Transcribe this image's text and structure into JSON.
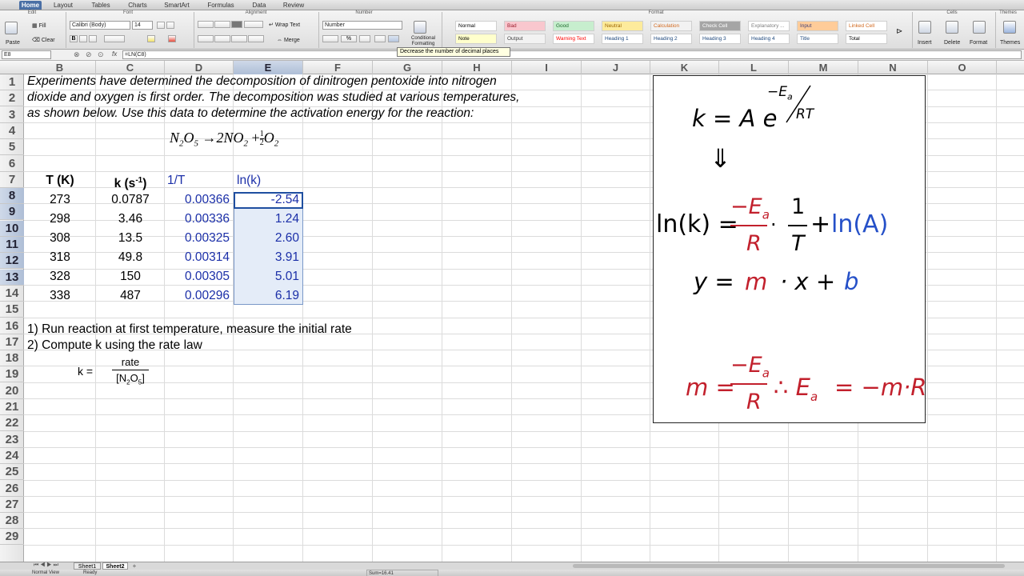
{
  "ribbon": {
    "tabs": [
      "Home",
      "Layout",
      "Tables",
      "Charts",
      "SmartArt",
      "Formulas",
      "Data",
      "Review"
    ],
    "groups": {
      "edit": "Edit",
      "font": "Font",
      "alignment": "Alignment",
      "number": "Number",
      "format": "Format",
      "cells": "Cells",
      "themes": "Themes"
    },
    "fill_label": "Fill",
    "clear_label": "Clear",
    "paste_label": "Paste",
    "font_name": "Calibri (Body)",
    "font_size": "14",
    "wrap_text": "Wrap Text",
    "merge": "Merge",
    "number_format": "Number",
    "conditional_formatting": "Conditional Formatting",
    "styles": [
      {
        "label": "Normal",
        "bg": "#ffffff",
        "fg": "#000000"
      },
      {
        "label": "Bad",
        "bg": "#f9c7ce",
        "fg": "#9c1c2c"
      },
      {
        "label": "Good",
        "bg": "#c7eece",
        "fg": "#1d6b2b"
      },
      {
        "label": "Neutral",
        "bg": "#fdeb9c",
        "fg": "#9c6500"
      },
      {
        "label": "Calculation",
        "bg": "#f2f2f2",
        "fg": "#d2691e"
      },
      {
        "label": "Check Cell",
        "bg": "#a5a5a5",
        "fg": "#ffffff"
      },
      {
        "label": "Explanatory ...",
        "bg": "#ffffff",
        "fg": "#7f7f7f"
      },
      {
        "label": "Input",
        "bg": "#ffcc99",
        "fg": "#3f3f76"
      },
      {
        "label": "Linked Cell",
        "bg": "#ffffff",
        "fg": "#d2691e"
      },
      {
        "label": "Note",
        "bg": "#ffffcc",
        "fg": "#000000"
      },
      {
        "label": "Output",
        "bg": "#f2f2f2",
        "fg": "#3f3f3f"
      },
      {
        "label": "Warning Text",
        "bg": "#ffffff",
        "fg": "#ff0000"
      },
      {
        "label": "Heading 1",
        "bg": "#ffffff",
        "fg": "#1f497d"
      },
      {
        "label": "Heading 2",
        "bg": "#ffffff",
        "fg": "#1f497d"
      },
      {
        "label": "Heading 3",
        "bg": "#ffffff",
        "fg": "#1f497d"
      },
      {
        "label": "Heading 4",
        "bg": "#ffffff",
        "fg": "#1f497d"
      },
      {
        "label": "Title",
        "bg": "#ffffff",
        "fg": "#1f497d"
      },
      {
        "label": "Total",
        "bg": "#ffffff",
        "fg": "#000000"
      }
    ],
    "cells_buttons": [
      "Insert",
      "Delete",
      "Format"
    ],
    "themes_label": "Themes",
    "tooltip": "Decrease the number of decimal places"
  },
  "formula_bar": {
    "cell_ref": "E8",
    "fx": "fx",
    "formula": "=LN(C8)"
  },
  "columns": [
    "B",
    "C",
    "D",
    "E",
    "F",
    "G",
    "H",
    "I",
    "J",
    "K",
    "L",
    "M",
    "N",
    "O"
  ],
  "rows": [
    "1",
    "2",
    "3",
    "4",
    "5",
    "6",
    "7",
    "8",
    "9",
    "10",
    "11",
    "12",
    "13",
    "14",
    "15",
    "16",
    "17",
    "18",
    "19",
    "20",
    "21",
    "22",
    "23",
    "24",
    "25",
    "26",
    "27",
    "28",
    "29"
  ],
  "sheet": {
    "intro_lines": [
      "Experiments have determined the decomposition of dinitrogen pentoxide into nitrogen",
      "dioxide and oxygen is first order.  The decomposition was studied at various temperatures,",
      "as shown below.  Use this data to determine the activation energy for the reaction:"
    ],
    "reaction": {
      "n": "N",
      "two": "2",
      "o": "O",
      "five": "5",
      "arrow": "→",
      "two_no": "2NO",
      "sub2": "2",
      "plus": "+",
      "half_num": "1",
      "half_den": "2",
      "o2": "O",
      "o2sub": "2"
    },
    "headers": {
      "T": "T (K)",
      "k": "k (s",
      "k_sup": "-1",
      "k_close": ")",
      "invT": "1/T",
      "lnk": "ln(k)"
    },
    "table": [
      {
        "T": "273",
        "k": "0.0787",
        "invT": "0.00366",
        "lnk": "-2.54"
      },
      {
        "T": "298",
        "k": "3.46",
        "invT": "0.00336",
        "lnk": "1.24"
      },
      {
        "T": "308",
        "k": "13.5",
        "invT": "0.00325",
        "lnk": "2.60"
      },
      {
        "T": "318",
        "k": "49.8",
        "invT": "0.00314",
        "lnk": "3.91"
      },
      {
        "T": "328",
        "k": "150",
        "invT": "0.00305",
        "lnk": "5.01"
      },
      {
        "T": "338",
        "k": "487",
        "invT": "0.00296",
        "lnk": "6.19"
      }
    ],
    "steps": [
      "1)  Run reaction at first temperature, measure the initial rate",
      "2)  Compute k using the rate law"
    ],
    "rate_law": {
      "k": "k =",
      "num": "rate",
      "den_open": "[N",
      "den_sub1": "2",
      "den_mid": "O",
      "den_sub2": "5",
      "den_close": "]"
    }
  },
  "equations": {
    "arrhenius": {
      "lhs": "k = A e",
      "exp_minus": "−E",
      "exp_sub": "a",
      "exp_den": "RT"
    },
    "implies": "⇓",
    "linear": {
      "ln": "ln(k) =",
      "num": "−E",
      "sub": "a",
      "den": "R",
      "dot": "·",
      "one": "1",
      "T": "T",
      "plus": "+",
      "lnA": "ln(A)"
    },
    "yline": {
      "y": "y =",
      "m": "m",
      "dotx": "· x +",
      "b": "b"
    },
    "slope": {
      "m": "m =",
      "num": "−E",
      "sub": "a",
      "den": "R",
      "therefore": "∴ E",
      "sub2": "a",
      "rest": "= −m·R"
    }
  },
  "tabs": {
    "sheet1": "Sheet1",
    "sheet2": "Sheet2",
    "add": "+"
  },
  "status": {
    "view": "Normal View",
    "ready": "Ready",
    "sum": "Sum=16.41"
  },
  "colors": {
    "accent_blue": "#1b2fa8",
    "eq_red": "#c2202c",
    "eq_blue": "#2550c8",
    "selection": "#e4ecf8"
  }
}
